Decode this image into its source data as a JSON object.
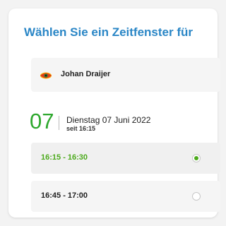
{
  "header": {
    "title": "Wählen Sie ein Zeitfenster für"
  },
  "person": {
    "name": "Johan Draijer",
    "icon": "eye-logo-icon"
  },
  "date": {
    "day_number": "07",
    "day_label": "Dienstag 07 Juni 2022",
    "since_label": "seit 16:15"
  },
  "slots": [
    {
      "label": "16:15 - 16:30",
      "selected": true
    },
    {
      "label": "16:45 - 17:00",
      "selected": false
    }
  ],
  "colors": {
    "title": "#2a86c6",
    "accent_green": "#4caa1c",
    "day_number": "#2ea82e"
  }
}
